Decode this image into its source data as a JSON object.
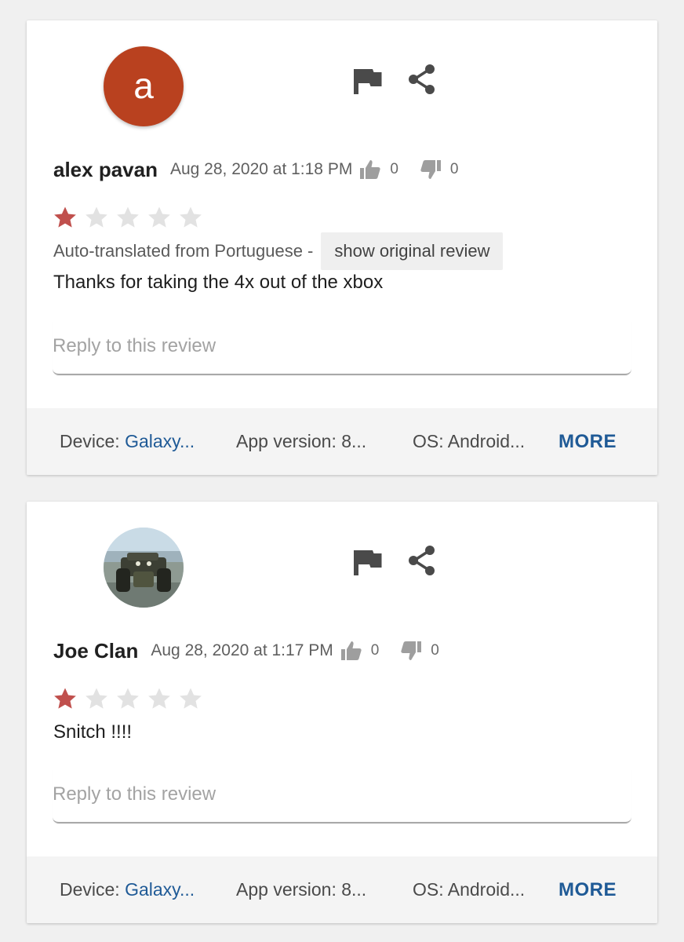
{
  "colors": {
    "accent_link": "#1f5a96",
    "star_filled": "#c0504d",
    "star_empty": "#e2e2e2",
    "avatar_letter_bg": "#b9411f",
    "icon_gray": "#4a4a4a"
  },
  "icons": {
    "flag": "flag-icon",
    "share": "share-icon",
    "thumbs_up": "thumbs-up-icon",
    "thumbs_down": "thumbs-down-icon",
    "star": "star-icon"
  },
  "reviews": [
    {
      "avatar_type": "letter",
      "avatar_letter": "a",
      "author": "alex pavan",
      "date": "Aug 28, 2020 at 1:18 PM",
      "upvotes": "0",
      "downvotes": "0",
      "rating": 1,
      "rating_max": 5,
      "translated_label": "Auto-translated from Portuguese -",
      "show_original_label": "show original review",
      "text": "Thanks for taking the 4x out of the xbox",
      "reply_placeholder": "Reply to this review",
      "footer": {
        "device_label": "Device:",
        "device_value": "Galaxy...",
        "app_version": "App version: 8...",
        "os": "OS: Android...",
        "more": "MORE"
      }
    },
    {
      "avatar_type": "photo",
      "author": "Joe Clan",
      "date": "Aug 28, 2020 at 1:17 PM",
      "upvotes": "0",
      "downvotes": "0",
      "rating": 1,
      "rating_max": 5,
      "text": "Snitch !!!!",
      "reply_placeholder": "Reply to this review",
      "footer": {
        "device_label": "Device:",
        "device_value": "Galaxy...",
        "app_version": "App version: 8...",
        "os": "OS: Android...",
        "more": "MORE"
      }
    }
  ]
}
